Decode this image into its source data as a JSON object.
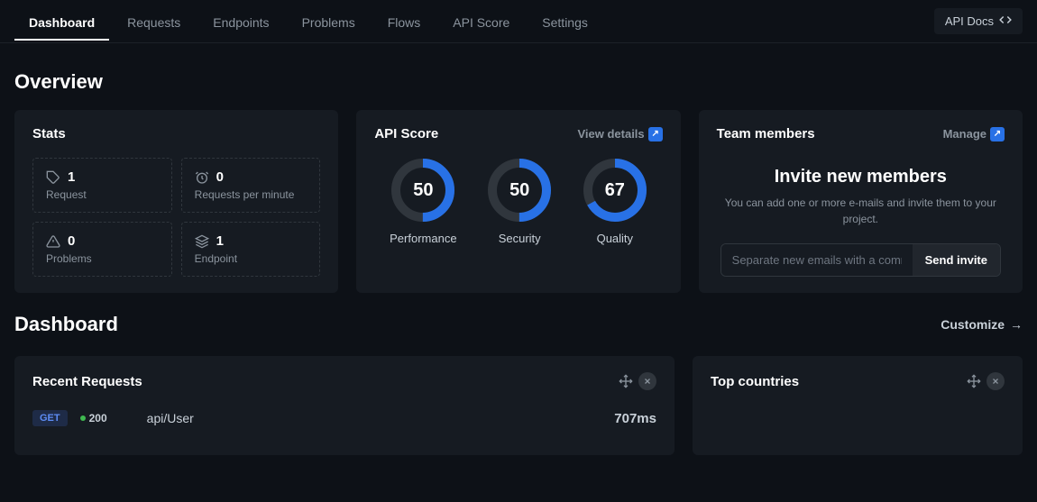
{
  "nav": {
    "tabs": [
      "Dashboard",
      "Requests",
      "Endpoints",
      "Problems",
      "Flows",
      "API Score",
      "Settings"
    ],
    "active_index": 0,
    "api_docs": "API Docs"
  },
  "overview_title": "Overview",
  "stats": {
    "title": "Stats",
    "items": [
      {
        "value": "1",
        "label": "Request",
        "icon": "tag"
      },
      {
        "value": "0",
        "label": "Requests per minute",
        "icon": "timer"
      },
      {
        "value": "0",
        "label": "Problems",
        "icon": "warning"
      },
      {
        "value": "1",
        "label": "Endpoint",
        "icon": "layers"
      }
    ]
  },
  "api_score": {
    "title": "API Score",
    "view_details": "View details",
    "scores": [
      {
        "label": "Performance",
        "value": 50
      },
      {
        "label": "Security",
        "value": 50
      },
      {
        "label": "Quality",
        "value": 67
      }
    ]
  },
  "team": {
    "title": "Team members",
    "manage": "Manage",
    "invite_title": "Invite new members",
    "invite_sub": "You can add one or more e-mails and invite them to your project.",
    "placeholder": "Separate new emails with a comma",
    "send_btn": "Send invite"
  },
  "dashboard": {
    "title": "Dashboard",
    "customize": "Customize"
  },
  "recent_requests": {
    "title": "Recent Requests",
    "rows": [
      {
        "method": "GET",
        "status": "200",
        "path": "api/User",
        "time": "707ms"
      }
    ]
  },
  "top_countries": {
    "title": "Top countries"
  }
}
